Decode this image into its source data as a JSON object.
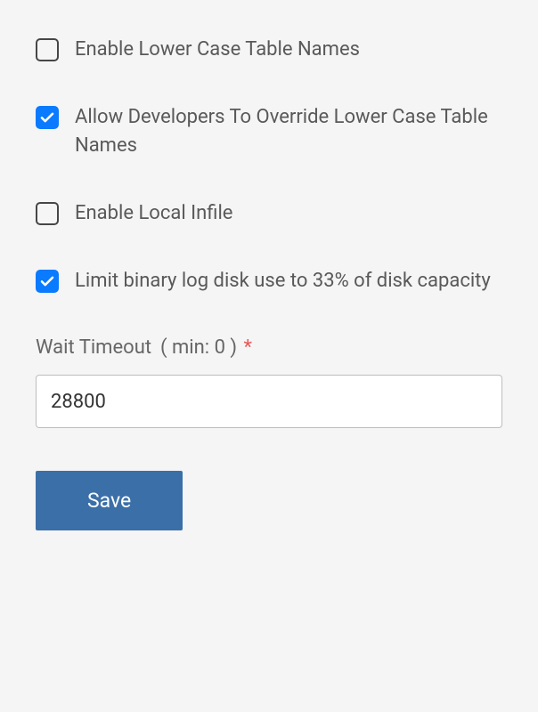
{
  "options": {
    "lower_case": {
      "label": "Enable Lower Case Table Names",
      "checked": false
    },
    "override_lower_case": {
      "label": "Allow Developers To Override Lower Case Table Names",
      "checked": true
    },
    "local_infile": {
      "label": "Enable Local Infile",
      "checked": false
    },
    "limit_binlog": {
      "label": "Limit binary log disk use to 33% of disk capacity",
      "checked": true
    }
  },
  "wait_timeout": {
    "label": "Wait Timeout",
    "hint": "( min: 0 )",
    "required_marker": "*",
    "value": "28800"
  },
  "buttons": {
    "save": "Save"
  }
}
